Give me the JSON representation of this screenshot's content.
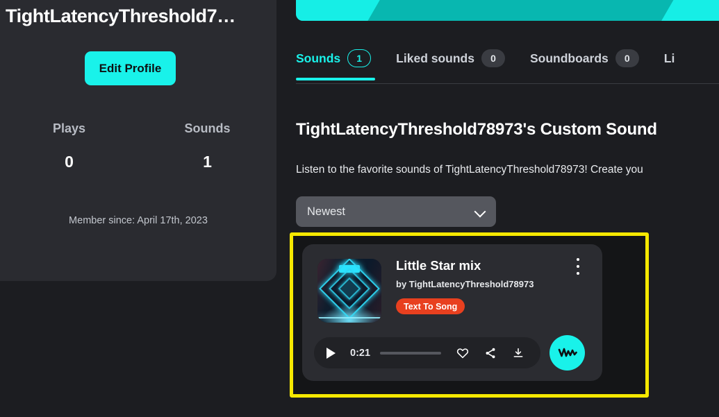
{
  "profile": {
    "display_name": "TightLatencyThreshold7…",
    "edit_profile_label": "Edit Profile",
    "stats": [
      {
        "label": "Plays",
        "value": "0"
      },
      {
        "label": "Sounds",
        "value": "1"
      }
    ],
    "member_since": "Member since: April 17th, 2023"
  },
  "tabs": [
    {
      "label": "Sounds",
      "count": "1",
      "active": true
    },
    {
      "label": "Liked sounds",
      "count": "0",
      "active": false
    },
    {
      "label": "Soundboards",
      "count": "0",
      "active": false
    },
    {
      "label": "Li",
      "count": "",
      "active": false
    }
  ],
  "main": {
    "section_title": "TightLatencyThreshold78973's Custom Sound",
    "section_desc": "Listen to the favorite sounds of TightLatencyThreshold78973! Create you",
    "sort": {
      "value": "Newest",
      "icon": "chevron-down-icon"
    }
  },
  "sound_card": {
    "title": "Little Star mix",
    "author": "by TightLatencyThreshold78973",
    "tag": "Text To Song",
    "menu_icon": "kebab-menu-icon",
    "thumbnail_alt": "neon-tunnel-artwork",
    "player": {
      "play_icon": "play-icon",
      "time": "0:21",
      "like_icon": "heart-icon",
      "share_icon": "share-icon",
      "download_icon": "download-icon",
      "waveform_icon": "waveform-icon"
    }
  },
  "colors": {
    "accent_cyan": "#19f2ea",
    "highlight_yellow": "#f5e800",
    "tag_red": "#e8401f",
    "page_bg": "#1c1d21",
    "panel_bg": "#2a2b30"
  }
}
